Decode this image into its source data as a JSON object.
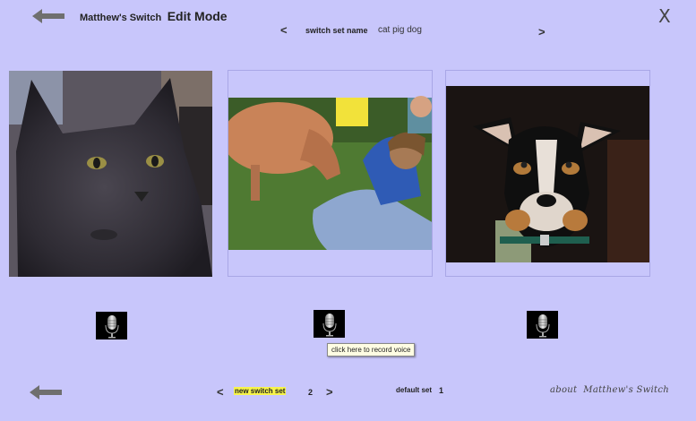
{
  "header": {
    "app_name": "Matthew's Switch",
    "mode_label": "Edit Mode",
    "close_label": "X"
  },
  "set_nav": {
    "prev_label": "<",
    "next_label": ">",
    "field_label": "switch set name",
    "value": "cat pig dog"
  },
  "cards": [
    {
      "picture": "gray-cat-photo"
    },
    {
      "picture": "pig-and-child-photo"
    },
    {
      "picture": "black-and-tan-dog-photo"
    }
  ],
  "tooltip": "click here to record voice",
  "footer": {
    "prev_label": "<",
    "new_set_label": "new switch set",
    "set_number": "2",
    "next_label": ">",
    "default_label": "default set",
    "default_value": "1",
    "about_label": "about  Matthew's Switch"
  },
  "icons": {
    "back": "back-arrow-icon",
    "mic": "microphone-icon"
  },
  "colors": {
    "background": "#c8c6fb",
    "highlight": "#f7f44a",
    "card_border": "#a9a7e6"
  }
}
